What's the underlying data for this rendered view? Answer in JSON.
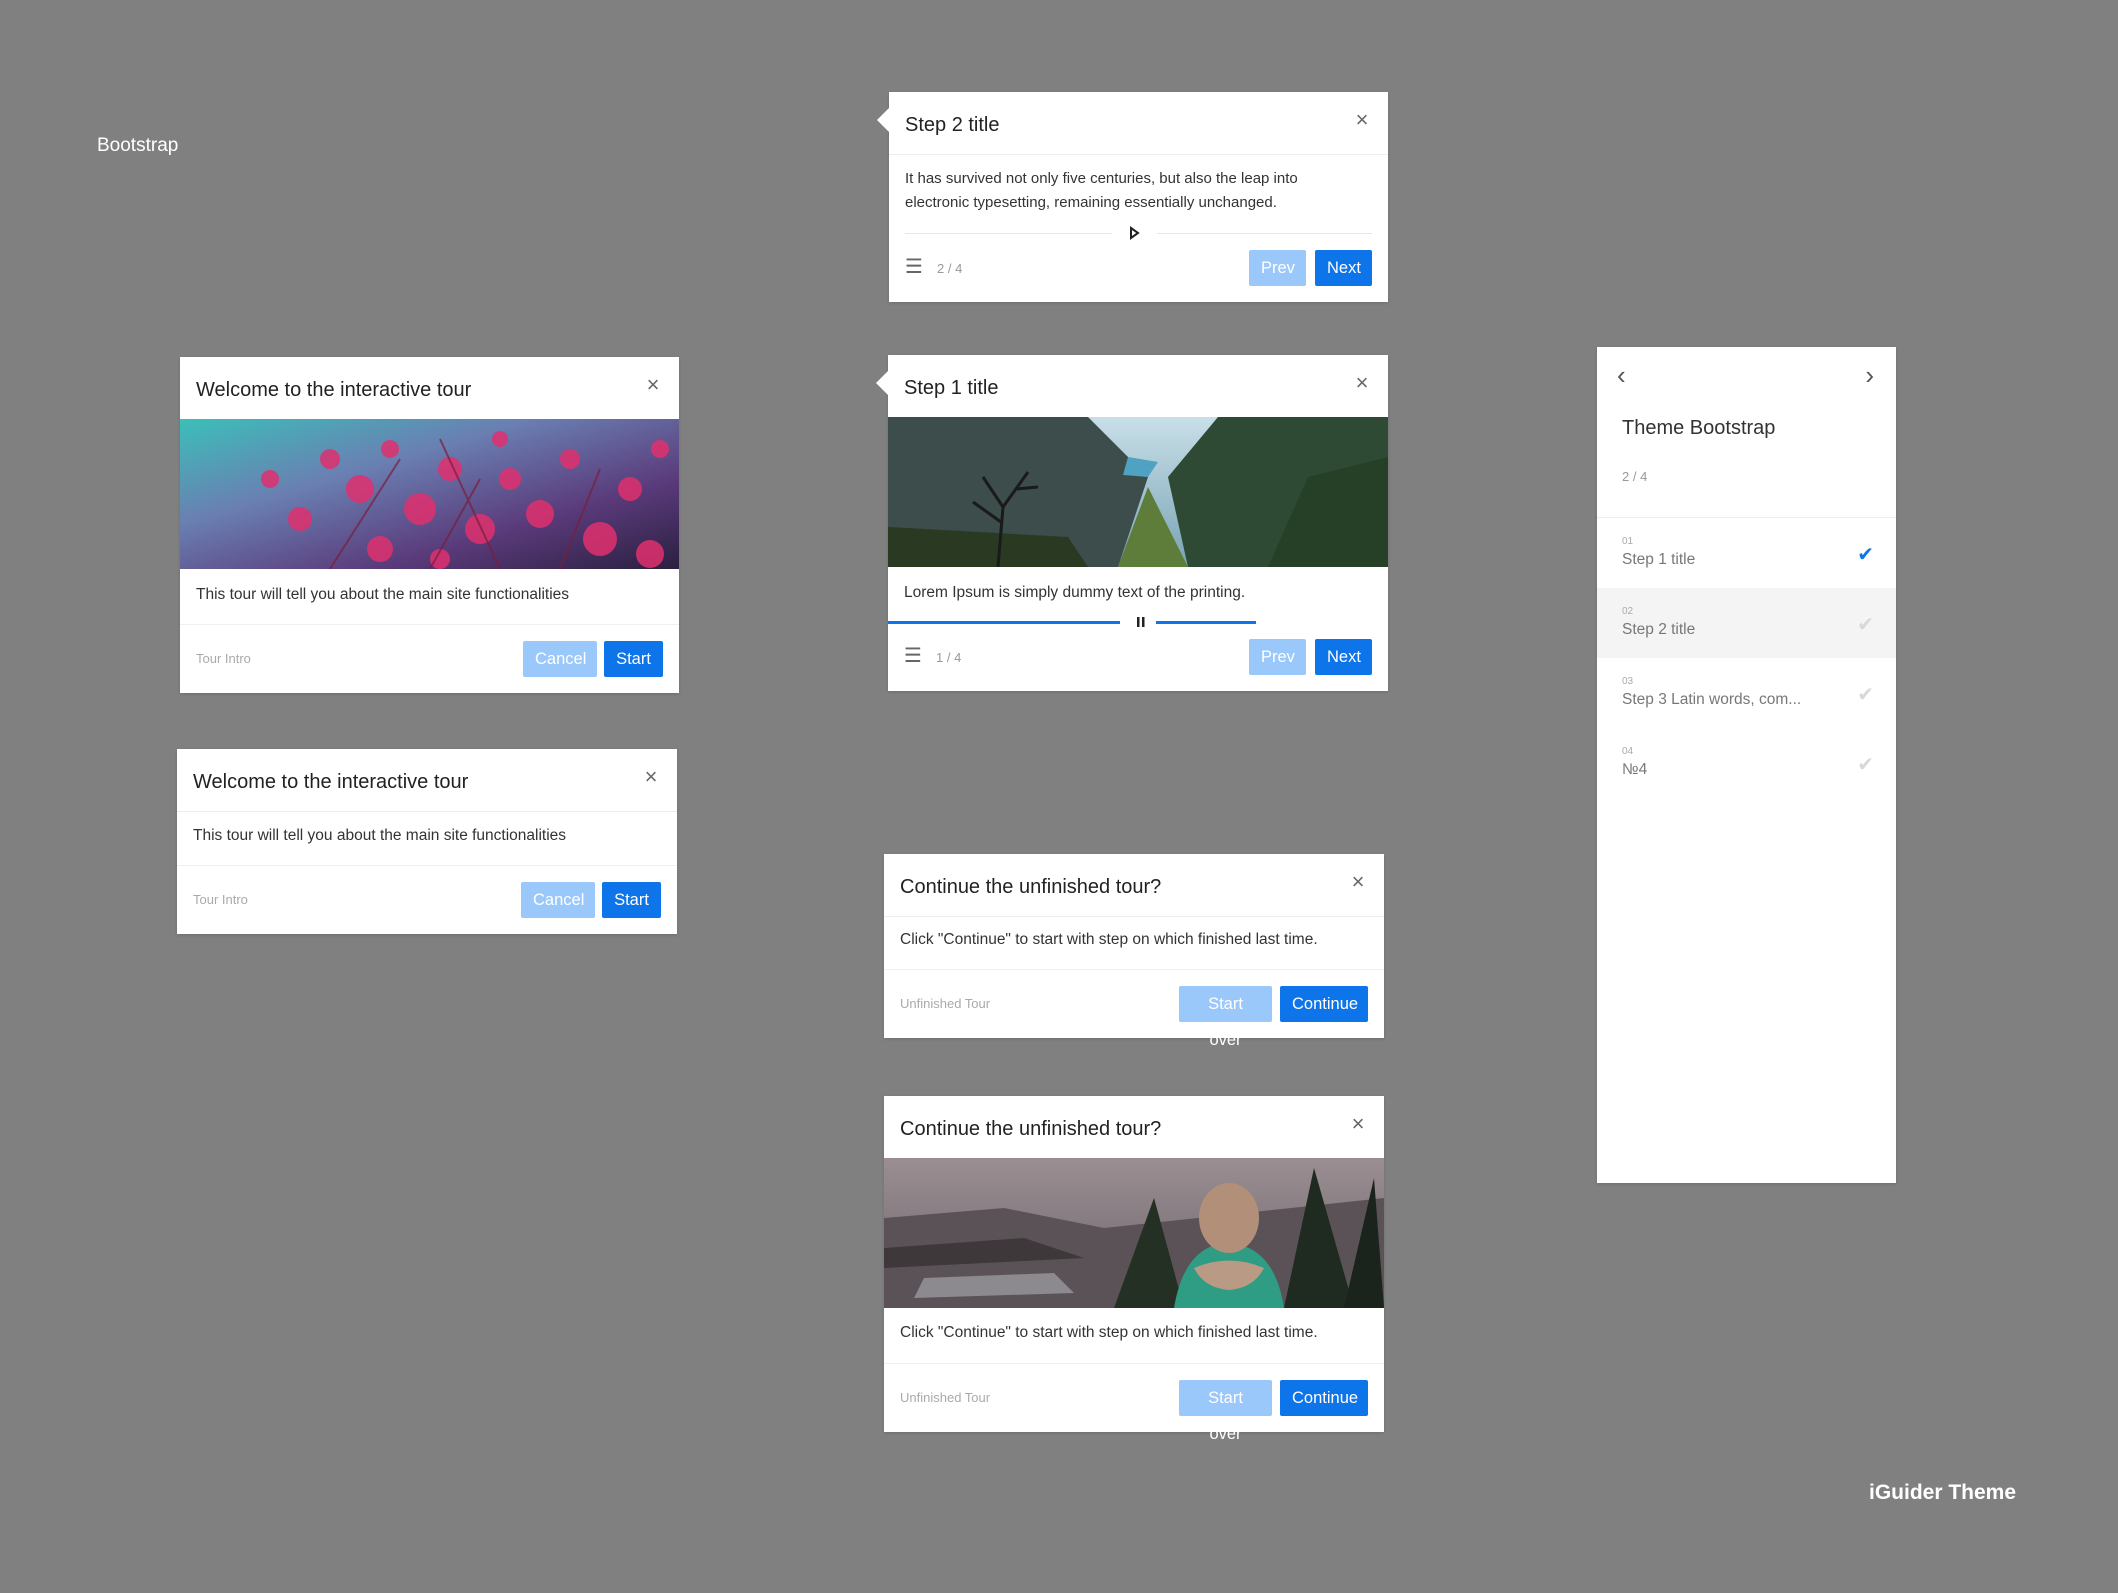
{
  "labels": {
    "framework": "Bootstrap",
    "theme": "iGuider Theme"
  },
  "step2_card": {
    "title": "Step 2 title",
    "text": "It has survived not only five centuries, but also the leap into electronic typesetting, remaining essentially unchanged.",
    "counter": "2 / 4",
    "prev": "Prev",
    "next": "Next",
    "progress": 0
  },
  "welcome_image_card": {
    "title": "Welcome to the interactive tour",
    "text": "This tour will tell you about the main site functionalities",
    "footer": "Tour Intro",
    "cancel": "Cancel",
    "start": "Start"
  },
  "step1_card": {
    "title": "Step 1 title",
    "text": "Lorem Ipsum is simply dummy text of the printing.",
    "counter": "1 / 4",
    "prev": "Prev",
    "next": "Next",
    "progress": 0.75
  },
  "welcome_card": {
    "title": "Welcome to the interactive tour",
    "text": "This tour will tell you about the main site functionalities",
    "footer": "Tour Intro",
    "cancel": "Cancel",
    "start": "Start"
  },
  "continue_card": {
    "title": "Continue the unfinished tour?",
    "text": "Click \"Continue\" to start with step on which finished last time.",
    "footer": "Unfinished Tour",
    "start_over": "Start over",
    "continue": "Continue"
  },
  "continue_image_card": {
    "title": "Continue the unfinished tour?",
    "text": "Click \"Continue\" to start with step on which finished last time.",
    "footer": "Unfinished Tour",
    "start_over": "Start over",
    "continue": "Continue"
  },
  "sidebar": {
    "title": "Theme Bootstrap",
    "counter": "2 / 4",
    "steps": [
      {
        "num": "01",
        "title": "Step 1 title",
        "done": true
      },
      {
        "num": "02",
        "title": "Step 2 title",
        "done": false
      },
      {
        "num": "03",
        "title": "Step 3 Latin words, com...",
        "done": false
      },
      {
        "num": "04",
        "title": "№4",
        "done": false
      }
    ]
  },
  "colors": {
    "accent": "#0d74ea",
    "accent_light": "#9ac8fa",
    "background": "#808080"
  }
}
